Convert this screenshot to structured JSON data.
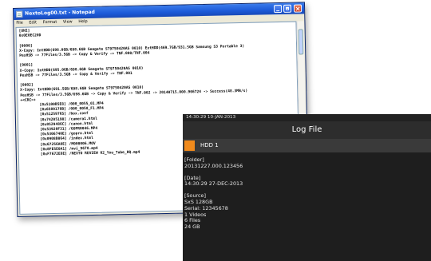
{
  "notepad": {
    "title": "NextoLog00.txt - Notepad",
    "menu": [
      "File",
      "Edit",
      "Format",
      "View",
      "Help"
    ],
    "lines": [
      "[UNI]",
      "0x0E0EC20D",
      "",
      "[0000]",
      "X-Copy: IntHDD(698.0GB/698.6GB Seagate ST9750420AS 0010) ExtHDD(469.7GB/931.5GB Samsung S3 Portable 3)",
      "PexHSB -> 77Files/3.5GB -> Copy & Verify -> TNF.000/TNF.004",
      "",
      "[0001]",
      "X-Copy: IntHDD(695.0GB/698.6GB Seagate ST9750420AS 0010)",
      "PexHSB -> 77Files/3.5GB -> Copy & Verify -> TNF.001",
      "",
      "[0002]",
      "X-Copy: IntHDD(691.5GB/698.6GB Seagate ST9750420AS 0010)",
      "PexHSB -> 77Files/3.5GB/698.6GB -> Copy & Verify -> TNF.002 -> 20140715.000.966724 -> Success(48.3MB/s)",
      "+<CRC>+"
    ],
    "files": [
      "[0x5100B5E8] /000_0055_01.MP4",
      "[0x6589178B] /000_0058_F1.MP4",
      "[0x5125976S] /box.conf",
      "[0x74205190] /camera1.html",
      "[0x0529486C] /canon.html",
      "[0x53920F31] /GOPR0046.MP4",
      "[0x5306740E] /gopro.html",
      "[0x0908B064] /index.html",
      "[0x67256A0E] /M000006.MOV",
      "[0x8FE5E0A1] /mvi_9678.mp4",
      "[0xF7672E8E] /NEXTO REVIEW 02_You_Tube_HQ.mp4"
    ]
  },
  "tv": {
    "status_time": "14:30:29 10-JAN-2013",
    "title": "Log File",
    "hdd_label": "HDD 1",
    "hdd_color": "#f08a1c",
    "folder_header": "[Folder]",
    "folder_value": "20131227.000.123456",
    "date_header": "[Date]",
    "date_value": "14:30:29 27-DEC-2013",
    "source_header": "[Source]",
    "source_lines": [
      "SxS 128GB",
      "Serial: 12345678",
      "1 Videos",
      "6 Files",
      "24 GB"
    ]
  }
}
